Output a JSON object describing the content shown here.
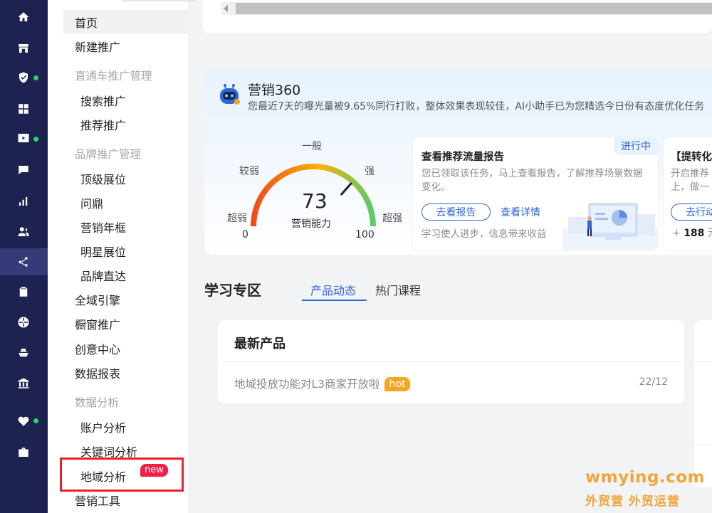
{
  "rail": {
    "icons": [
      "home-icon",
      "store-icon",
      "shield-check-icon",
      "apps-icon",
      "video-icon",
      "chat-icon",
      "bar-chart-icon",
      "users-icon",
      "share-icon",
      "clipboard-icon",
      "globe-icon",
      "ship-icon",
      "bank-icon",
      "heart-icon",
      "briefcase-icon"
    ],
    "active": "share-icon",
    "dot_color": "#2bd36b"
  },
  "menu": {
    "home": "首页",
    "new_promo": "新建推广",
    "grp_ztc": "直通车推广管理",
    "search_promo": "搜索推广",
    "recommend_promo": "推荐推广",
    "grp_brand": "品牌推广管理",
    "top_display": "顶级展位",
    "wending": "问鼎",
    "annual_frame": "营销年框",
    "star_display": "明星展位",
    "brand_direct": "品牌直达",
    "full_domain": "全域引擎",
    "showcase": "橱窗推广",
    "creative_center": "创意中心",
    "data_report": "数据报表",
    "grp_analysis": "数据分析",
    "account_analysis": "账户分析",
    "keyword_analysis": "关键词分析",
    "region_analysis": "地域分析",
    "region_badge": "new",
    "marketing_tools": "营销工具"
  },
  "marketing": {
    "title": "营销360",
    "desc": "您最近7天的曝光量被9.65%同行打败，整体效果表现较佳，AI小助手已为您精选今日份有态度优化任务",
    "gauge": {
      "score": "73",
      "name": "营销能力",
      "min": "0",
      "max": "100",
      "labels": [
        "超弱",
        "较弱",
        "一般",
        "强",
        "超强"
      ],
      "value": 73,
      "colors": [
        "#f04a1a",
        "#f7b500",
        "#5cc96a"
      ]
    },
    "task1": {
      "title": "查看推荐流量报告",
      "status": "进行中",
      "desc": "您已领取该任务，马上查看报告，了解推荐场景数据变化。",
      "btn": "去看报告",
      "link": "查看详情",
      "foot": "学习使人进步，信息带来收益"
    },
    "task2": {
      "title": "【提转化",
      "desc_line1": "开启推荐",
      "desc_line2": "上，做一",
      "btn": "去行动",
      "reward_prefix": "+",
      "reward_value": "188",
      "reward_unit": "元"
    }
  },
  "learning": {
    "title": "学习专区",
    "tabs": [
      "产品动态",
      "热门课程"
    ],
    "active_tab": 0,
    "card_title": "最新产品",
    "item_text": "地域投放功能对L3商家开放啦",
    "item_badge": "hot",
    "item_date": "22/12"
  },
  "watermark": {
    "line1": "wmying.com",
    "line2": "外贸营 外贸运营"
  }
}
